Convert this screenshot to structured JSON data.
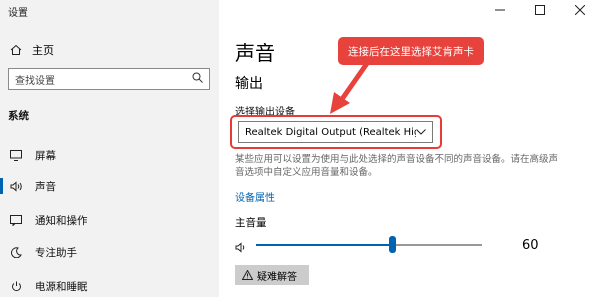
{
  "window": {
    "title": "设置",
    "controls": [
      "—",
      "☐",
      "✕"
    ]
  },
  "sidebar": {
    "home_label": "主页",
    "search_placeholder": "查找设置",
    "section": "系统",
    "items": [
      {
        "label": "屏幕",
        "icon": "monitor-icon"
      },
      {
        "label": "声音",
        "icon": "speaker-icon",
        "active": true
      },
      {
        "label": "通知和操作",
        "icon": "notification-icon"
      },
      {
        "label": "专注助手",
        "icon": "moon-icon"
      },
      {
        "label": "电源和睡眠",
        "icon": "power-icon"
      }
    ]
  },
  "main": {
    "title": "声音",
    "section": "输出",
    "output_label": "选择输出设备",
    "output_device": "Realtek Digital Output (Realtek High...",
    "description": "某些应用可以设置为使用与此处选择的声音设备不同的声音设备。请在高级声音选项中自定义应用音量和设备。",
    "device_props_link": "设备属性",
    "volume_label": "主音量",
    "volume_value": "60",
    "volume_level": 0.6,
    "troubleshoot_label": "疑难解答"
  },
  "annotation": {
    "callout_text": "连接后在这里选择艾肯声卡",
    "color": "#e8423d"
  },
  "colors": {
    "accent": "#0063b1",
    "sidebar_bg": "#f2f2f2",
    "highlight": "#e63b36"
  }
}
